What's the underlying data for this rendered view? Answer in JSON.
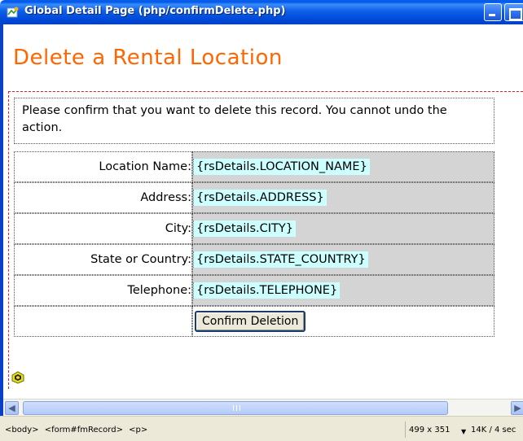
{
  "window": {
    "title": "Global Detail Page (php/confirmDelete.php)"
  },
  "page": {
    "heading": "Delete a Rental Location",
    "message": "Please confirm that you want to delete this record. You cannot undo the action.",
    "fields": [
      {
        "label": "Location Name:",
        "value": "{rsDetails.LOCATION_NAME}"
      },
      {
        "label": "Address:",
        "value": "{rsDetails.ADDRESS}"
      },
      {
        "label": "City:",
        "value": "{rsDetails.CITY}"
      },
      {
        "label": "State or Country:",
        "value": "{rsDetails.STATE_COUNTRY}"
      },
      {
        "label": "Telephone:",
        "value": "{rsDetails.TELEPHONE}"
      }
    ],
    "confirm_button": "Confirm Deletion"
  },
  "statusbar": {
    "tags": [
      "<body>",
      "<form#fmRecord>",
      "<p>"
    ],
    "window_size": "499 x 351",
    "download_stats": "14K / 4 sec"
  },
  "colors": {
    "heading": "#ff6600",
    "dynamic_text_bg": "#ccffff",
    "value_cell_bg": "#d4d4d4",
    "titlebar": "#0058ee"
  },
  "icons": {
    "title_icon": "dreamweaver-page-icon",
    "php_marker": "php-code-marker-icon"
  }
}
